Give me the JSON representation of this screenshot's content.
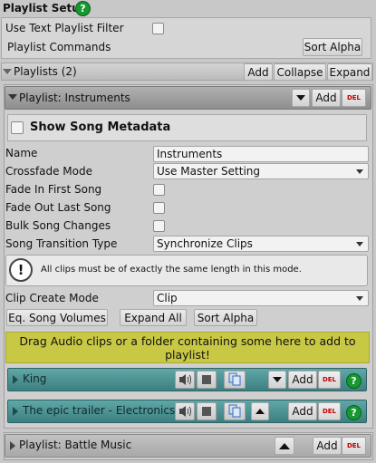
{
  "setup": {
    "title": "Playlist Setup",
    "help_icon": "question-mark-icon",
    "use_text_filter_label": "Use Text Playlist Filter",
    "use_text_filter_checked": false,
    "commands_label": "Playlist Commands",
    "sort_alpha_label": "Sort Alpha"
  },
  "playlists_header": {
    "label": "Playlists (2)",
    "add_label": "Add",
    "collapse_label": "Collapse",
    "expand_label": "Expand"
  },
  "playlist1": {
    "header": "Playlist: Instruments",
    "add_label": "Add",
    "del_label": "DEL",
    "show_metadata_label": "Show Song Metadata",
    "show_metadata_checked": false,
    "name_label": "Name",
    "name_value": "Instruments",
    "crossfade_label": "Crossfade Mode",
    "crossfade_value": "Use Master Setting",
    "fade_in_label": "Fade In First Song",
    "fade_out_label": "Fade Out Last Song",
    "bulk_changes_label": "Bulk Song Changes",
    "transition_label": "Song Transition Type",
    "transition_value": "Synchronize Clips",
    "info_text": "All clips must be of exactly the same length in this mode.",
    "clip_mode_label": "Clip Create Mode",
    "clip_mode_value": "Clip",
    "eq_volumes_label": "Eq. Song Volumes",
    "expand_all_label": "Expand All",
    "sort_alpha_label": "Sort Alpha",
    "drop_text": "Drag Audio clips or a folder containing some here to add to playlist!",
    "songs": [
      {
        "name": "King",
        "add_label": "Add",
        "del_label": "DEL"
      },
      {
        "name": "The epic trailer - Electronics",
        "add_label": "Add",
        "del_label": "DEL"
      }
    ]
  },
  "playlist2": {
    "header": "Playlist: Battle Music",
    "add_label": "Add",
    "del_label": "DEL"
  },
  "colors": {
    "drop_zone": "#c8c845",
    "song_row": "#4e9596",
    "delete_text": "#c00000",
    "help_green": "#149a2e"
  }
}
